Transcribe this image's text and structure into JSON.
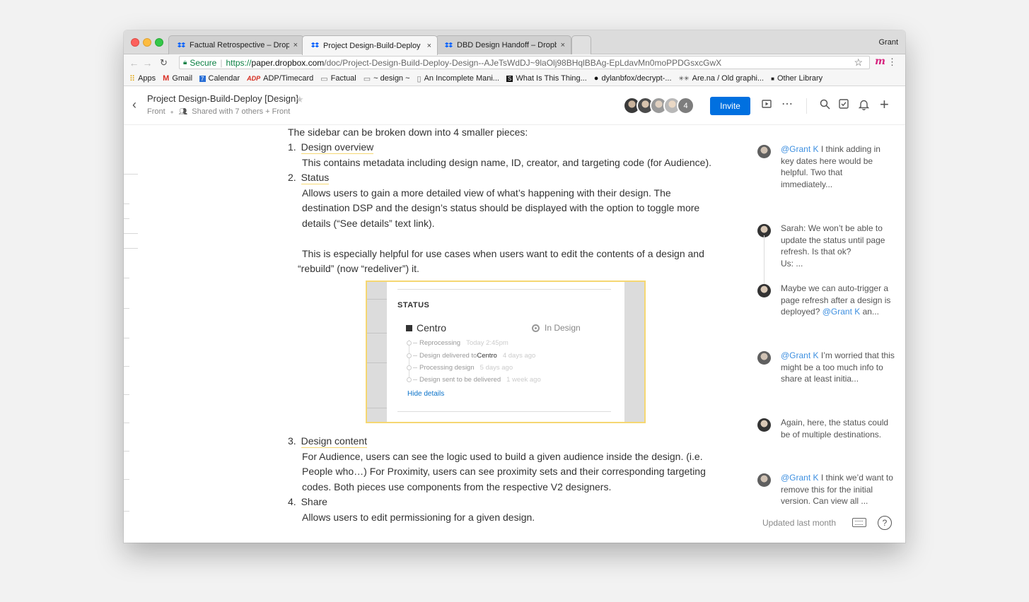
{
  "browser": {
    "user": "Grant",
    "tabs": [
      {
        "label": "Factual Retrospective – Dropb",
        "close": "×"
      },
      {
        "label": "Project Design-Build-Deploy [",
        "close": "×"
      },
      {
        "label": "DBD Design Handoff – Dropbo",
        "close": "×"
      }
    ],
    "secure_label": "Secure",
    "url_scheme": "https://",
    "url_host": "paper.dropbox.com",
    "url_path": "/doc/Project-Design-Build-Deploy-Design--AJeTsWdDJ~9laOlj98BHqlBBAg-EpLdavMn0moPPDGsxcGwX",
    "bookmarks": [
      {
        "label": "Apps",
        "icon": "apps-grid-icon"
      },
      {
        "label": "Gmail",
        "icon": "gmail-icon"
      },
      {
        "label": "Calendar",
        "icon": "calendar-icon"
      },
      {
        "label": "ADP/Timecard",
        "icon": "adp-icon"
      },
      {
        "label": "Factual",
        "icon": "folder-icon"
      },
      {
        "label": "~ design ~",
        "icon": "folder-icon"
      },
      {
        "label": "An Incomplete Mani...",
        "icon": "page-icon"
      },
      {
        "label": "What Is This Thing...",
        "icon": "bookmark-icon"
      },
      {
        "label": "dylanbfox/decrypt-...",
        "icon": "github-icon"
      },
      {
        "label": "Are.na / Old graphi...",
        "icon": "arena-icon"
      },
      {
        "label": "Other Library",
        "icon": "square-icon"
      }
    ]
  },
  "header": {
    "title": "Project Design-Build-Deploy [Design]",
    "folder": "Front",
    "shared": "Shared with 7 others + Front",
    "collaborator_count": "4",
    "invite_label": "Invite"
  },
  "doc": {
    "intro": "The sidebar can be broken down into 4 smaller pieces:",
    "items": [
      {
        "num": "1.",
        "title": "Design overview",
        "body": [
          "This contains metadata including design name, ID, creator, and targeting code (for Audience)."
        ]
      },
      {
        "num": "2.",
        "title": "Status",
        "body": [
          "Allows users to gain a more detailed view of what’s happening with their design. The",
          "destination DSP and the design’s status should be displayed with the option to toggle more",
          "details (“See details” text link).",
          "This is especially helpful for use cases when users want to edit the contents of a design and",
          "“rebuild” (now “redeliver”) it."
        ]
      },
      {
        "num": "3.",
        "title": "Design content",
        "body": [
          "For Audience, users can see the logic used to build a given audience inside the design. (i.e.",
          "People who…) For Proximity, users can see proximity sets and their corresponding targeting",
          "codes. Both pieces use components from the respective V2 designers."
        ]
      },
      {
        "num": "4.",
        "title": "Share",
        "body": [
          "Allows users to edit permissioning for a given design."
        ]
      }
    ],
    "embed": {
      "heading": "STATUS",
      "name": "Centro",
      "state": "In Design",
      "timeline": [
        {
          "text": "Reprocessing",
          "bold": "",
          "when": "Today 2:45pm"
        },
        {
          "text": "Design delivered to ",
          "bold": "Centro",
          "when": "4 days ago"
        },
        {
          "text": "Processing design",
          "bold": "",
          "when": "5 days ago"
        },
        {
          "text": "Design sent to be delivered",
          "bold": "",
          "when": "1 week ago"
        }
      ],
      "toggle": "Hide details"
    }
  },
  "comments": [
    {
      "mention": "@Grant K",
      "text": " I think adding in key dates here would be helpful. Two that immediately..."
    },
    {
      "mention": "",
      "text": "Sarah: We won’t be able to update the status until page refresh. Is that ok?\nUs: ..."
    },
    {
      "mention": "",
      "text": "Maybe we can auto-trigger a page refresh after a design is deployed? ",
      "mention_after": "@Grant K",
      "tail": " an..."
    },
    {
      "mention": "@Grant K",
      "text": " I’m worried that this might be a too much info to share at least initia..."
    },
    {
      "mention": "",
      "text": "Again, here, the status could be of multiple destinations."
    },
    {
      "mention": "@Grant K",
      "text": " I think we’d want to remove this for the initial version. Can view all ..."
    }
  ],
  "footer": {
    "updated": "Updated last month",
    "help": "?"
  },
  "colors": {
    "accent": "#0070e0",
    "highlight": "#f5d772",
    "mention": "#3d8fe0"
  }
}
